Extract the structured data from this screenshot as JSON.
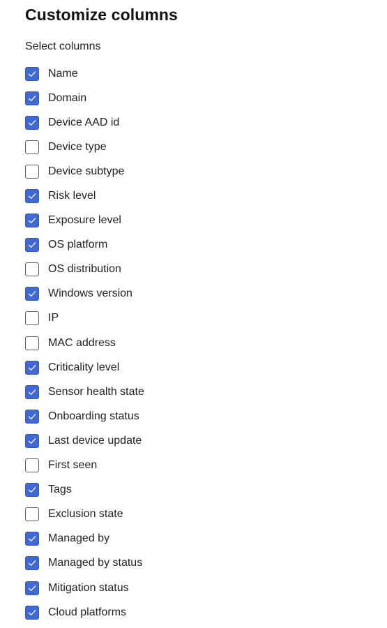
{
  "panel": {
    "title": "Customize columns",
    "section_label": "Select columns"
  },
  "colors": {
    "checked_fill": "#4169d6",
    "unchecked_border": "#5f5f5f"
  },
  "columns": [
    {
      "label": "Name",
      "checked": true
    },
    {
      "label": "Domain",
      "checked": true
    },
    {
      "label": "Device AAD id",
      "checked": true
    },
    {
      "label": "Device type",
      "checked": false
    },
    {
      "label": "Device subtype",
      "checked": false
    },
    {
      "label": "Risk level",
      "checked": true
    },
    {
      "label": "Exposure level",
      "checked": true
    },
    {
      "label": "OS platform",
      "checked": true
    },
    {
      "label": "OS distribution",
      "checked": false
    },
    {
      "label": "Windows version",
      "checked": true
    },
    {
      "label": "IP",
      "checked": false
    },
    {
      "label": "MAC address",
      "checked": false
    },
    {
      "label": "Criticality level",
      "checked": true
    },
    {
      "label": "Sensor health state",
      "checked": true
    },
    {
      "label": "Onboarding status",
      "checked": true
    },
    {
      "label": "Last device update",
      "checked": true
    },
    {
      "label": "First seen",
      "checked": false
    },
    {
      "label": "Tags",
      "checked": true
    },
    {
      "label": "Exclusion state",
      "checked": false
    },
    {
      "label": "Managed by",
      "checked": true
    },
    {
      "label": "Managed by status",
      "checked": true
    },
    {
      "label": "Mitigation status",
      "checked": true
    },
    {
      "label": "Cloud platforms",
      "checked": true
    }
  ]
}
